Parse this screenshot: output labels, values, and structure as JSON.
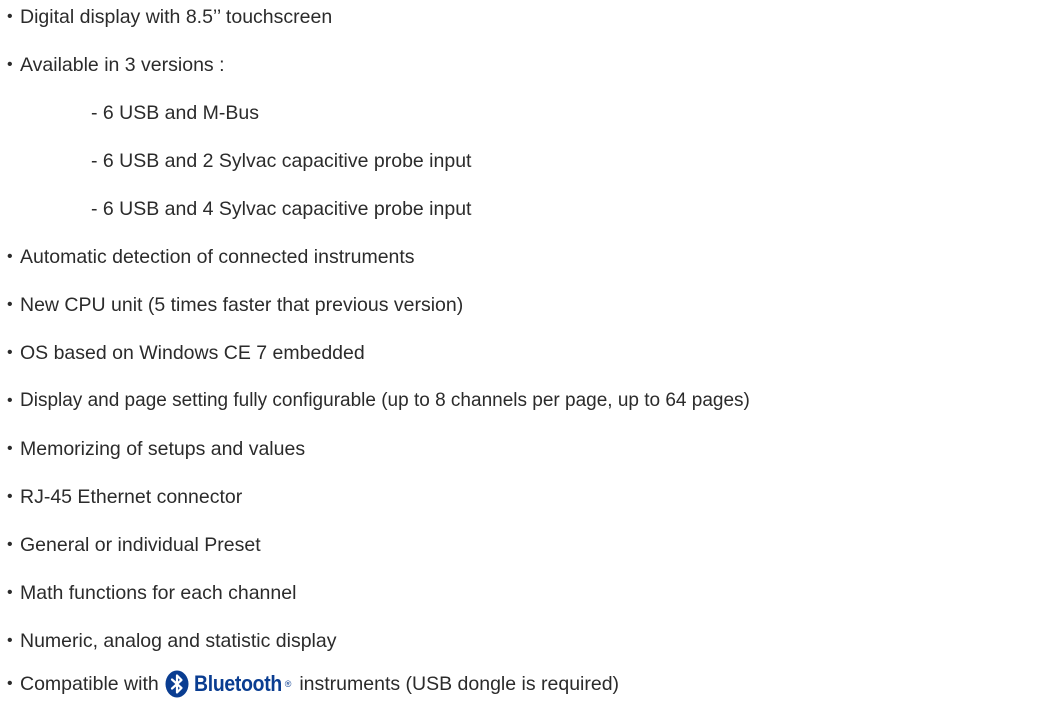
{
  "bullet_glyph": "•",
  "items": [
    {
      "text": "Digital display with 8.5’’ touchscreen"
    },
    {
      "text": "Available in 3 versions :"
    },
    {
      "text": "- 6 USB and M-Bus"
    },
    {
      "text": "- 6 USB and 2 Sylvac capacitive probe input"
    },
    {
      "text": "- 6 USB and 4 Sylvac capacitive probe input"
    },
    {
      "text": "Automatic detection of connected instruments"
    },
    {
      "text": "New CPU unit (5 times faster that previous version)"
    },
    {
      "text": "OS based on Windows CE 7 embedded"
    },
    {
      "text": "Display and page setting fully configurable (up to 8 channels per page, up to 64 pages)"
    },
    {
      "text": "Memorizing of setups and values"
    },
    {
      "text": "RJ-45 Ethernet connector"
    },
    {
      "text": "General or individual Preset"
    },
    {
      "text": "Math functions for each channel"
    },
    {
      "text": "Numeric, analog and statistic display"
    }
  ],
  "bluetooth_item": {
    "prefix": "Compatible with",
    "logo_word": "Bluetooth",
    "logo_reg": "®",
    "suffix": "instruments (USB dongle is required)",
    "brand_color": "#0a3d91",
    "icon": "bluetooth-icon"
  }
}
